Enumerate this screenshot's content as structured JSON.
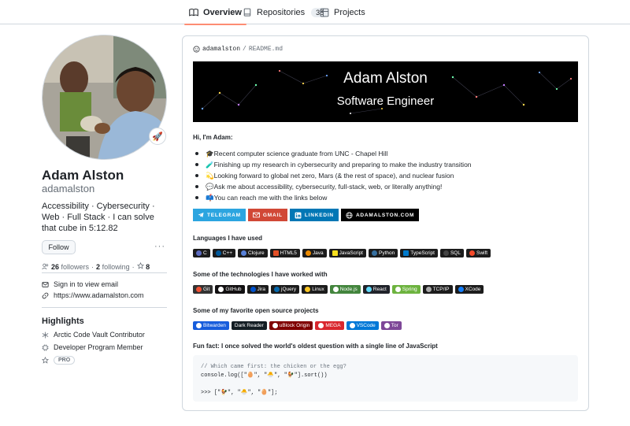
{
  "tabs": [
    {
      "label": "Overview",
      "icon": "book-icon",
      "active": true
    },
    {
      "label": "Repositories",
      "icon": "repo-icon",
      "count": "38"
    },
    {
      "label": "Projects",
      "icon": "table-icon"
    }
  ],
  "profile": {
    "full_name": "Adam Alston",
    "username": "adamalston",
    "bio": "Accessibility · Cybersecurity · Web · Full Stack · I can solve that cube in 5:12.82",
    "status_emoji": "🚀",
    "follow_label": "Follow",
    "more_label": "···",
    "followers_count": "26",
    "followers_label": "followers",
    "following_count": "2",
    "following_label": "following",
    "stars_count": "8",
    "dot": "·",
    "email_label": "Sign in to view email",
    "website": "https://www.adamalston.com"
  },
  "highlights": {
    "title": "Highlights",
    "items": [
      {
        "label": "Arctic Code Vault Contributor",
        "icon": "archive-icon"
      },
      {
        "label": "Developer Program Member",
        "icon": "cpu-icon"
      },
      {
        "label": "PRO",
        "icon": "star-icon"
      }
    ]
  },
  "readme": {
    "owner": "adamalston",
    "separator": "/",
    "file": "README.md",
    "banner_title": "Adam Alston",
    "banner_subtitle": "Software Engineer",
    "greeting": "Hi, I'm Adam:",
    "bullets": [
      {
        "emoji": "🎓",
        "text": "Recent computer science graduate from UNC - Chapel Hill"
      },
      {
        "emoji": "🧪",
        "text": "Finishing up my research in cybersecurity and preparing to make the industry transition"
      },
      {
        "emoji": "💫",
        "text": "Looking forward to global net zero, Mars (& the rest of space), and nuclear fusion"
      },
      {
        "emoji": "💬",
        "text": "Ask me about accessibility, cybersecurity, full-stack, web, or literally anything!"
      },
      {
        "emoji": "📫",
        "text": "You can reach me with the links below"
      }
    ],
    "contacts": [
      {
        "label": "TELEGRAM",
        "color": "#2ca5e0",
        "icon": "telegram-icon"
      },
      {
        "label": "GMAIL",
        "color": "#d14836",
        "icon": "mail-icon"
      },
      {
        "label": "LINKEDIN",
        "color": "#0077b5",
        "icon": "linkedin-icon"
      },
      {
        "label": "ADAMALSTON.COM",
        "color": "#000000",
        "icon": "globe-icon"
      }
    ],
    "languages_title": "Languages I have used",
    "languages": [
      {
        "label": "C",
        "color": "#1c1c1c",
        "dot": "#5c6bc0"
      },
      {
        "label": "C++",
        "color": "#1c1c1c",
        "dot": "#00599c"
      },
      {
        "label": "Clojure",
        "color": "#1c1c1c",
        "dot": "#5881d8"
      },
      {
        "label": "HTML5",
        "color": "#1c1c1c",
        "dot": "#e34f26"
      },
      {
        "label": "Java",
        "color": "#1c1c1c",
        "dot": "#ed8b00"
      },
      {
        "label": "JavaScript",
        "color": "#1c1c1c",
        "dot": "#f7df1e"
      },
      {
        "label": "Python",
        "color": "#1c1c1c",
        "dot": "#3670a0"
      },
      {
        "label": "TypeScript",
        "color": "#1c1c1c",
        "dot": "#007acc"
      },
      {
        "label": "SQL",
        "color": "#1c1c1c",
        "dot": "#444444"
      },
      {
        "label": "Swift",
        "color": "#1c1c1c",
        "dot": "#f54a2a"
      }
    ],
    "tech_title": "Some of the technologies I have worked with",
    "technologies": [
      {
        "label": "Git",
        "color": "#333333",
        "dot": "#f05033"
      },
      {
        "label": "GitHub",
        "color": "#121011",
        "dot": "#ffffff"
      },
      {
        "label": "Jira",
        "color": "#1c1c1c",
        "dot": "#0052cc"
      },
      {
        "label": "jQuery",
        "color": "#1c1c1c",
        "dot": "#0769ad"
      },
      {
        "label": "Linux",
        "color": "#1c1c1c",
        "dot": "#fcc624"
      },
      {
        "label": "Node.js",
        "color": "#43853d",
        "dot": "#ffffff"
      },
      {
        "label": "React",
        "color": "#20232a",
        "dot": "#61dafb"
      },
      {
        "label": "Spring",
        "color": "#6db33f",
        "dot": "#ffffff"
      },
      {
        "label": "TCP/IP",
        "color": "#1c1c1c",
        "dot": "#aaaaaa"
      },
      {
        "label": "XCode",
        "color": "#1c1c1c",
        "dot": "#147efb"
      }
    ],
    "oss_title": "Some of my favorite open source projects",
    "open_source": [
      {
        "label": "Bitwarden",
        "color": "#175ddc",
        "dot": "#ffffff"
      },
      {
        "label": "Dark Reader",
        "color": "#141e24",
        "dot": "#ffffff"
      },
      {
        "label": "uBlock Origin",
        "color": "#800000",
        "dot": "#ffffff"
      },
      {
        "label": "MEGA",
        "color": "#d9272e",
        "dot": "#ffffff"
      },
      {
        "label": "VSCode",
        "color": "#0078d7",
        "dot": "#ffffff"
      },
      {
        "label": "Tor",
        "color": "#7e4798",
        "dot": "#ffffff"
      }
    ],
    "fun_fact": "Fun fact: I once solved the world's oldest question with a single line of JavaScript",
    "code_lines": [
      "// Which came first: the chicken or the egg?",
      "console.log([\"🥚\", \"🐣\", \"🐓\"].sort())",
      "",
      ">>> [\"🐓\", \"🐣\", \"🥚\"];"
    ]
  }
}
